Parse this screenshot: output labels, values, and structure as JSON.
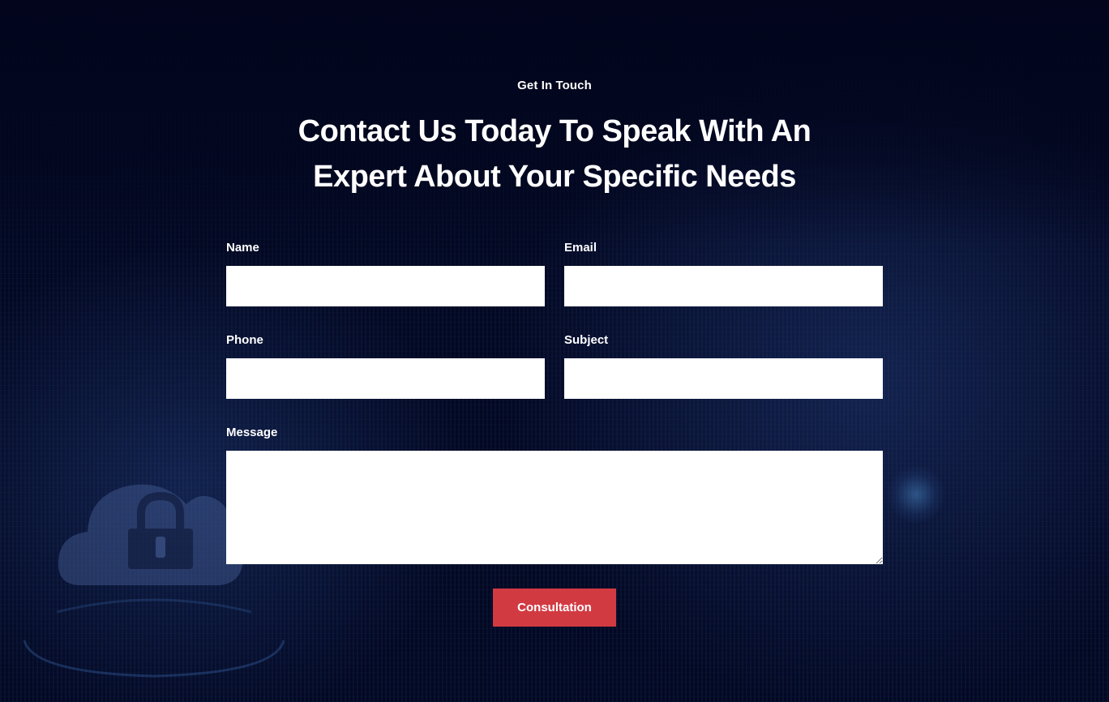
{
  "section": {
    "eyebrow": "Get In Touch",
    "heading_line1": "Contact Us Today To Speak With An",
    "heading_line2": "Expert About Your Specific Needs"
  },
  "form": {
    "name": {
      "label": "Name",
      "value": ""
    },
    "email": {
      "label": "Email",
      "value": ""
    },
    "phone": {
      "label": "Phone",
      "value": ""
    },
    "subject": {
      "label": "Subject",
      "value": ""
    },
    "message": {
      "label": "Message",
      "value": ""
    },
    "submit_label": "Consultation"
  },
  "background": {
    "icons": [
      "cloud-lock-icon",
      "glowing-orb"
    ]
  },
  "colors": {
    "background": "#030822",
    "text": "#ffffff",
    "input_background": "#ffffff",
    "button": "#d23a42"
  }
}
